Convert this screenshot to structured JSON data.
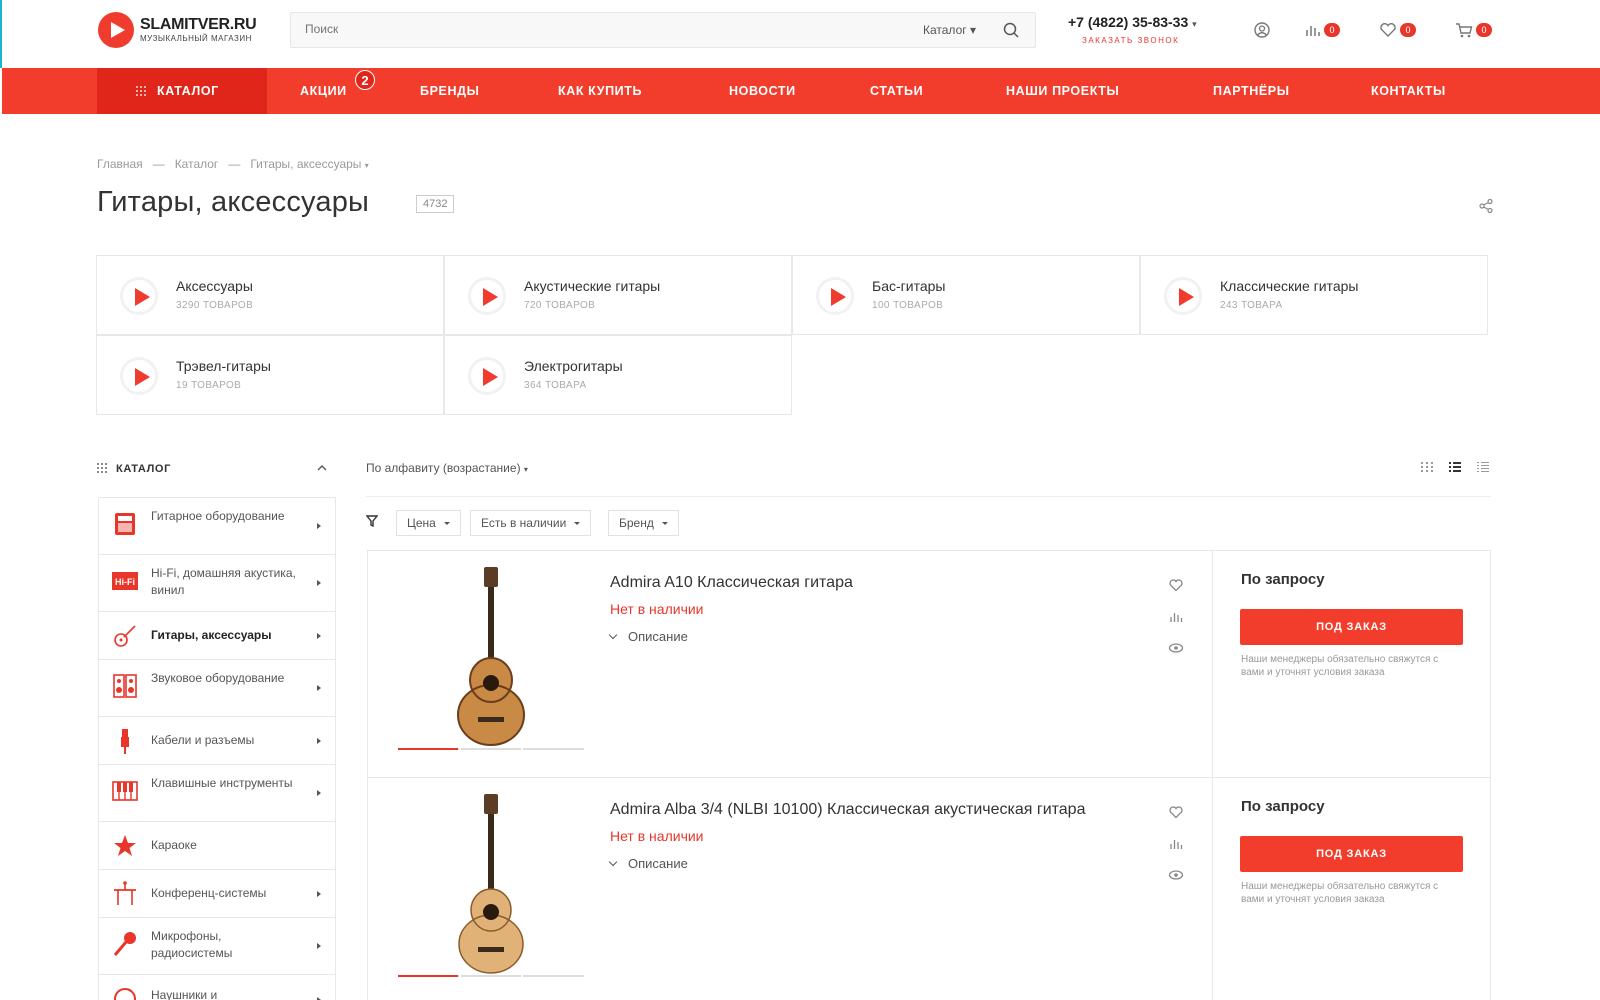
{
  "logo": {
    "name": "SLAMITVER.RU",
    "subtitle": "МУЗЫКАЛЬНЫЙ МАГАЗИН"
  },
  "search": {
    "placeholder": "Поиск",
    "category": "Каталог"
  },
  "contact": {
    "phone": "+7 (4822) 35-83-33",
    "callback": "ЗАКАЗАТЬ ЗВОНОК"
  },
  "header_counts": {
    "compare": "0",
    "favorites": "0",
    "cart": "0"
  },
  "nav": {
    "catalog": "КАТАЛОГ",
    "items": [
      "АКЦИИ",
      "БРЕНДЫ",
      "КАК КУПИТЬ",
      "НОВОСТИ",
      "СТАТЬИ",
      "НАШИ ПРОЕКТЫ",
      "ПАРТНЁРЫ",
      "КОНТАКТЫ"
    ],
    "promo_badge": "2"
  },
  "breadcrumb": [
    "Главная",
    "Каталог",
    "Гитары, аксессуары"
  ],
  "page": {
    "title": "Гитары, аксессуары",
    "count": "4732"
  },
  "categories": [
    {
      "name": "Аксессуары",
      "count": "3290 ТОВАРОВ"
    },
    {
      "name": "Акустические гитары",
      "count": "720 ТОВАРОВ"
    },
    {
      "name": "Бас-гитары",
      "count": "100 ТОВАРОВ"
    },
    {
      "name": "Классические гитары",
      "count": "243 ТОВАРА"
    },
    {
      "name": "Трэвел-гитары",
      "count": "19 ТОВАРОВ"
    },
    {
      "name": "Электрогитары",
      "count": "364 ТОВАРА"
    }
  ],
  "sidebar": {
    "title": "КАТАЛОГ",
    "items": [
      {
        "label": "Гитарное оборудование",
        "icon": "amp-icon"
      },
      {
        "label": "Hi-Fi, домашняя акустика, винил",
        "icon": "hifi-icon"
      },
      {
        "label": "Гитары, аксессуары",
        "icon": "guitar-icon"
      },
      {
        "label": "Звуковое оборудование",
        "icon": "speaker-icon"
      },
      {
        "label": "Кабели и разъемы",
        "icon": "cable-icon"
      },
      {
        "label": "Клавишные инструменты",
        "icon": "keyboard-icon"
      },
      {
        "label": "Караоке",
        "icon": "star-icon"
      },
      {
        "label": "Конференц-системы",
        "icon": "conference-icon"
      },
      {
        "label": "Микрофоны, радиосистемы",
        "icon": "microphone-icon"
      },
      {
        "label": "Наушники и",
        "icon": "headphones-icon"
      }
    ]
  },
  "toolbar": {
    "sort": "По алфавиту (возрастание)",
    "filters": [
      "Цена",
      "Есть в наличии",
      "Бренд"
    ]
  },
  "products": [
    {
      "name": "Admira A10 Классическая гитара",
      "stock": "Нет в наличии",
      "description": "Описание",
      "price": "По запросу",
      "button": "ПОД ЗАКАЗ",
      "note": "Наши менеджеры обязательно свяжутся с вами и уточнят условия заказа"
    },
    {
      "name": "Admira Alba 3/4 (NLBI 10100) Классическая акустическая гитара",
      "stock": "Нет в наличии",
      "description": "Описание",
      "price": "По запросу",
      "button": "ПОД ЗАКАЗ",
      "note": "Наши менеджеры обязательно свяжутся с вами и уточнят условия заказа"
    }
  ],
  "colors": {
    "accent": "#f23d2d",
    "accent_dark": "#e0261b",
    "stock_red": "#e8362b"
  }
}
